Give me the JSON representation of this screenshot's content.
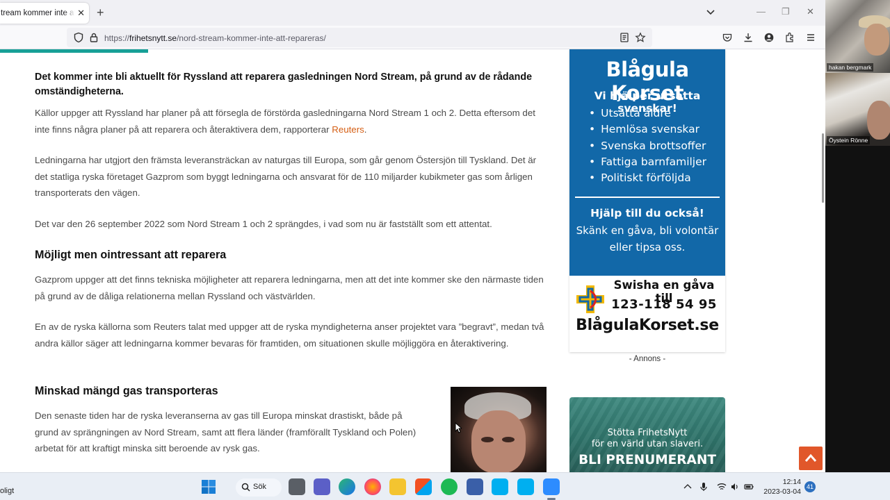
{
  "browser": {
    "tab_title": "tream kommer inte att repareras",
    "url_scheme": "https://",
    "url_host": "frihetsnytt.se",
    "url_path": "/nord-stream-kommer-inte-att-repareras/"
  },
  "article": {
    "lead": "Det kommer inte bli aktuellt för Ryssland att reparera gasledningen Nord Stream, på grund av de rådande omständigheterna.",
    "p1_text": "Källor uppger att Ryssland har planer på att försegla de förstörda gasledningarna Nord Stream 1 och 2. Detta eftersom det inte finns några planer på att reparera och återaktivera dem, rapporterar ",
    "p1_link": "Reuters",
    "p1_end": ".",
    "p2": "Ledningarna har utgjort den främsta leveransträckan av naturgas till Europa, som går genom Östersjön till Tyskland. Det är det statliga ryska företaget Gazprom som byggt ledningarna och ansvarat för de 110 miljarder kubikmeter gas som årligen transporterats den vägen.",
    "p3": "Det var den 26 september 2022 som Nord Stream 1 och 2 sprängdes, i vad som nu är fastställt som ett attentat.",
    "h2_1": "Möjligt men ointressant att reparera",
    "p4": "Gazprom uppger att det finns tekniska möjligheter att reparera ledningarna, men att det inte kommer ske den närmaste tiden på grund av de dåliga relationerna mellan Ryssland och västvärlden.",
    "p5": "En av de ryska källorna som Reuters talat med uppger att de ryska myndigheterna anser projektet vara ”begravt”, medan två andra källor säger att ledningarna kommer bevaras för framtiden, om situationen skulle möjliggöra en återaktivering.",
    "h2_2": "Minskad mängd gas transporteras",
    "p6": "Den senaste tiden har de ryska leveranserna av gas till Europa minskat drastiskt, både på grund av sprängningen av Nord Stream, samt att flera länder (framförallt Tyskland och Polen) arbetat för att kraftigt minska sitt beroende av rysk gas."
  },
  "ad1": {
    "title": "Blågula Korset",
    "subtitle": "Vi hjälper utsatta svenskar!",
    "items": [
      "Utsatta äldre",
      "Hemlösa svenskar",
      "Svenska brottsoffer",
      "Fattiga barnfamiljer",
      "Politiskt förföljda"
    ],
    "help_title": "Hjälp till du också!",
    "help_line1": "Skänk en gåva, bli volontär",
    "help_line2": "eller tipsa oss.",
    "swish": "Swisha en gåva till",
    "number": "123-118 54 95",
    "site": "BlågulaKorset.se",
    "annons": "- Annons -",
    "bg_color": "#1268a8"
  },
  "ad2": {
    "line1": "Stötta FrihetsNytt",
    "line2": "för en värld utan slaveri.",
    "line3": "BLI PRENUMERANT"
  },
  "video": {
    "name1": "hakan bergmark",
    "name2": "Öystein Rönne"
  },
  "taskbar": {
    "left_text": "oligt",
    "search_label": "Sök",
    "time": "12:14",
    "date": "2023-03-04",
    "notif_count": "41"
  },
  "colors": {
    "accent_progress": "#17a097",
    "link": "#d55e13",
    "to_top": "#e1572a"
  }
}
